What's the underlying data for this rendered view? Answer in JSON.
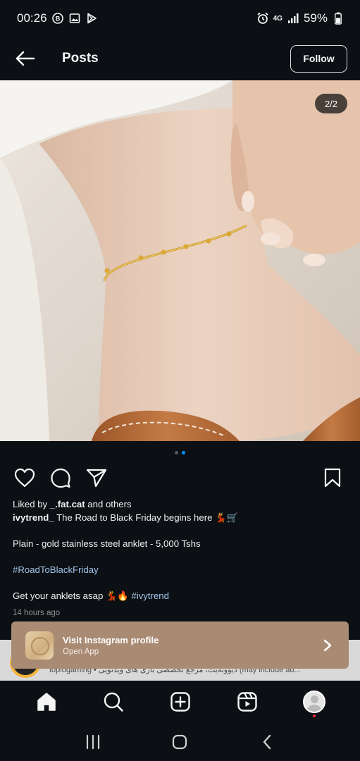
{
  "status_bar": {
    "time": "00:26",
    "network": "4G",
    "battery": "59%",
    "left_icons": [
      "b-circle-icon",
      "image-icon",
      "play-store-icon"
    ],
    "right_icons": [
      "alarm-icon",
      "signal-icon",
      "battery-icon"
    ]
  },
  "header": {
    "title": "Posts",
    "follow_label": "Follow"
  },
  "post": {
    "image_counter": "2/2",
    "image_description_icon": "anklet-photo",
    "carousel_dots": 2,
    "carousel_active": 2,
    "liked_by_prefix": "Liked by ",
    "liked_by_user": "_.fat.cat",
    "liked_by_suffix": " and others",
    "author": "ivytrend_",
    "caption_line1": " The Road to Black Friday begins here 💃🛒",
    "caption_line2": "Plain - gold stainless steel anklet - 5,000 Tshs",
    "caption_hashtag1": "#RoadToBlackFriday",
    "caption_line3": "Get your anklets asap 💃🔥 ",
    "caption_hashtag2": "#ivytrend",
    "timestamp": "14 hours ago"
  },
  "strip": {
    "text": "topiogaming • دیوونه‌یت، مرجع تخصصی بازی های ویدئویی (may include au..."
  },
  "visit_banner": {
    "title": "Visit Instagram profile",
    "subtitle": "Open App"
  },
  "colors": {
    "background": "#0c1014",
    "accent": "#0095f6",
    "banner": "#a98a73",
    "hashtag": "#a4c4ea"
  },
  "bottom_nav": [
    "home-icon",
    "search-icon",
    "create-icon",
    "reels-icon",
    "profile-icon"
  ],
  "system_nav": [
    "recents-icon",
    "home-circle-icon",
    "back-chevron-icon"
  ]
}
